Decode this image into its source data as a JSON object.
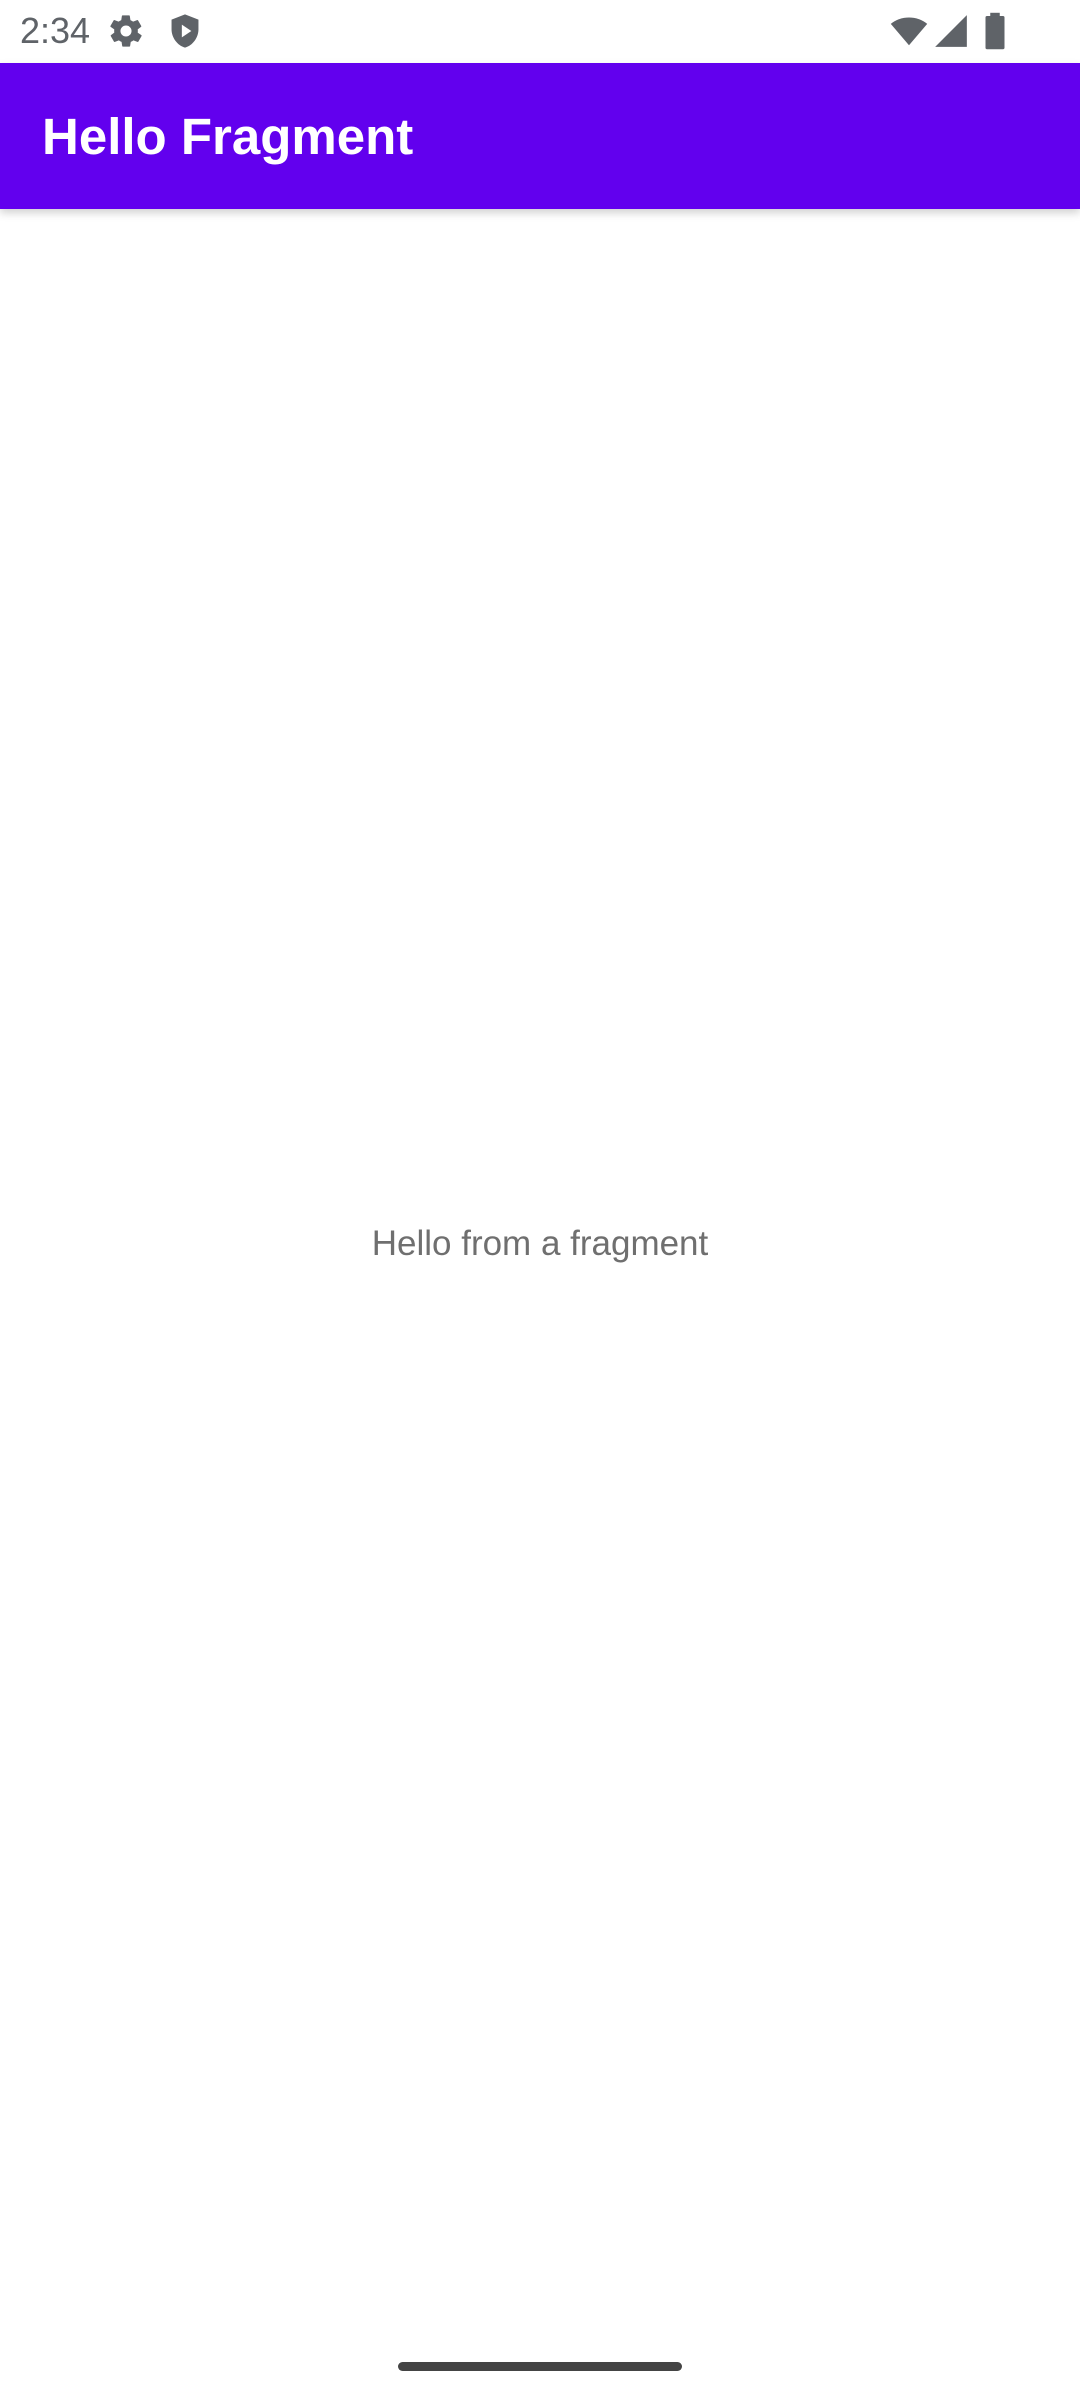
{
  "status_bar": {
    "time": "2:34",
    "left_icons": [
      "gear-icon",
      "shield-play-icon"
    ],
    "right_icons": [
      "wifi-icon",
      "cellular-signal-icon",
      "battery-icon"
    ]
  },
  "app_bar": {
    "title": "Hello Fragment",
    "color": "#6200ee"
  },
  "fragment": {
    "text": "Hello from a fragment"
  }
}
